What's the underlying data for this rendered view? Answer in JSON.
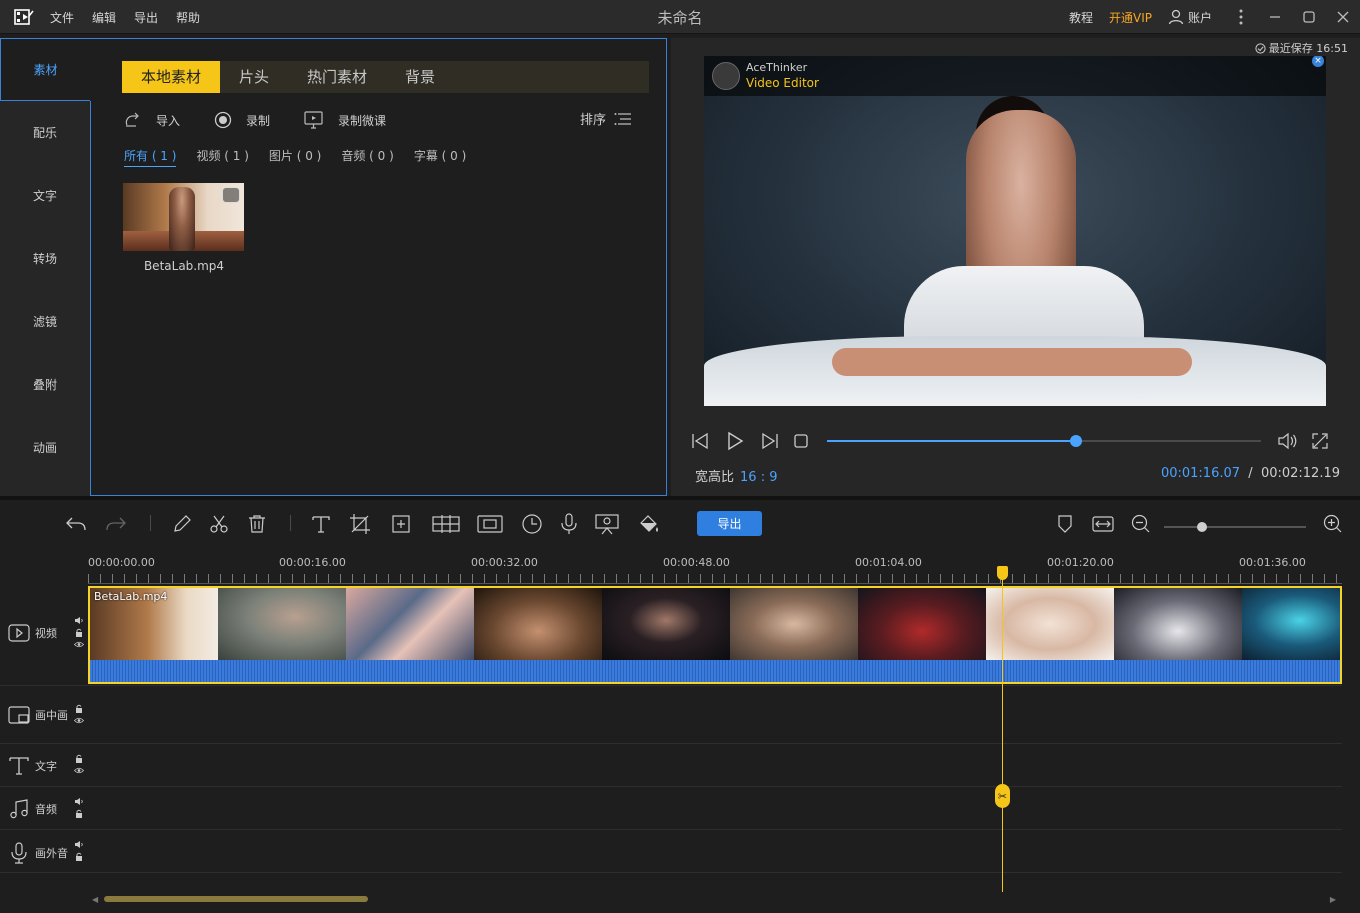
{
  "app": {
    "title": "未命名",
    "menu": [
      "文件",
      "编辑",
      "导出",
      "帮助"
    ],
    "tutorial": "教程",
    "vip": "开通VIP",
    "account": "账户"
  },
  "sidebar": {
    "tabs": [
      "素材",
      "配乐",
      "文字",
      "转场",
      "滤镜",
      "叠附",
      "动画"
    ],
    "active": "素材"
  },
  "library": {
    "sub_tabs": [
      "本地素材",
      "片头",
      "热门素材",
      "背景"
    ],
    "active_sub_tab": "本地素材",
    "actions": {
      "import": "导入",
      "record": "录制",
      "record_micro": "录制微课"
    },
    "sort_label": "排序",
    "filters": [
      "所有 ( 1 )",
      "视频 ( 1 )",
      "图片 ( 0 )",
      "音频 ( 0 )",
      "字幕 ( 0 )"
    ],
    "items": [
      {
        "name": "BetaLab.mp4"
      }
    ]
  },
  "preview": {
    "last_saved": "最近保存 16:51",
    "overlay_brand": "AceThinker",
    "overlay_product": "Video Editor",
    "aspect_label": "宽高比",
    "aspect_value": "16 : 9",
    "current_time": "00:01:16.07",
    "time_separator": "/",
    "total_time": "00:02:12.19",
    "progress": 0.573
  },
  "timeline": {
    "export_label": "导出",
    "zoom": 0.27,
    "ruler": [
      "00:00:00.00",
      "00:00:16.00",
      "00:00:32.00",
      "00:00:48.00",
      "00:01:04.00",
      "00:01:20.00",
      "00:01:36.00"
    ],
    "tracks": [
      "视频",
      "画中画",
      "文字",
      "音频",
      "画外音"
    ],
    "clip_name": "BetaLab.mp4",
    "playhead_time": "00:01:16.07"
  },
  "colors": {
    "accent_blue": "#4aa3ff",
    "accent_yellow": "#f5c518",
    "vip_orange": "#f5a623",
    "export_button": "#2e7fe0"
  }
}
